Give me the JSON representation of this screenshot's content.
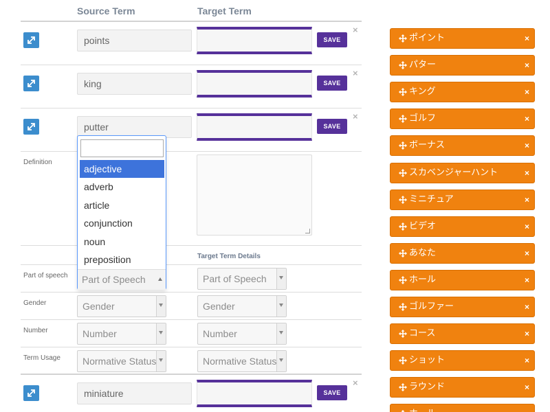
{
  "columns": {
    "source": "Source Term",
    "target": "Target Term"
  },
  "rows": [
    {
      "source": "points",
      "target": "",
      "save": "SAVE",
      "close": "×"
    },
    {
      "source": "king",
      "target": "",
      "save": "SAVE",
      "close": "×"
    },
    {
      "source": "putter",
      "target": "",
      "save": "SAVE",
      "close": "×"
    },
    {
      "source": "miniature",
      "target": "",
      "save": "SAVE",
      "close": "×"
    }
  ],
  "details": {
    "definition_label": "Definition",
    "target_details_heading": "Target Term Details",
    "fields": [
      {
        "label": "Part of speech",
        "source_placeholder": "Part of Speech",
        "target_placeholder": "Part of Speech"
      },
      {
        "label": "Gender",
        "source_placeholder": "Gender",
        "target_placeholder": "Gender"
      },
      {
        "label": "Number",
        "source_placeholder": "Number",
        "target_placeholder": "Number"
      },
      {
        "label": "Term Usage",
        "source_placeholder": "Normative Status",
        "target_placeholder": "Normative Status"
      }
    ]
  },
  "dropdown": {
    "search_value": "",
    "options": [
      "adjective",
      "adverb",
      "article",
      "conjunction",
      "noun",
      "preposition"
    ],
    "highlighted": "adjective",
    "current": "Part of Speech"
  },
  "tags": [
    {
      "label": "ポイント",
      "close": "×"
    },
    {
      "label": "パター",
      "close": "×"
    },
    {
      "label": "キング",
      "close": "×"
    },
    {
      "label": "ゴルフ",
      "close": "×"
    },
    {
      "label": "ボーナス",
      "close": "×"
    },
    {
      "label": "スカベンジャーハント",
      "close": "×"
    },
    {
      "label": "ミニチュア",
      "close": "×"
    },
    {
      "label": "ビデオ",
      "close": "×"
    },
    {
      "label": "あなた",
      "close": "×"
    },
    {
      "label": "ホール",
      "close": "×"
    },
    {
      "label": "ゴルファー",
      "close": "×"
    },
    {
      "label": "コース",
      "close": "×"
    },
    {
      "label": "ショット",
      "close": "×"
    },
    {
      "label": "ラウンド",
      "close": "×"
    },
    {
      "label": "ホール",
      "close": "×"
    }
  ],
  "colors": {
    "accent": "#56319a",
    "tag": "#f0820f",
    "expand": "#3c8dcd",
    "highlight": "#3d73db"
  }
}
